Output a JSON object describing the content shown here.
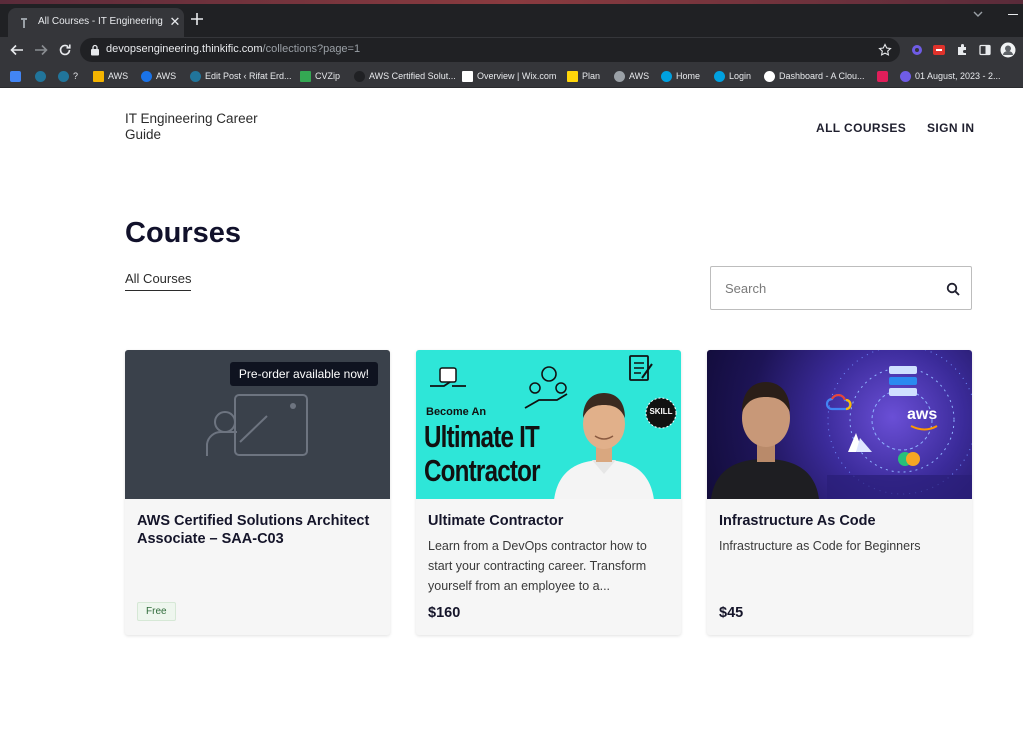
{
  "browser": {
    "tab_title": "All Courses - IT Engineering Career",
    "tab_close": "✕",
    "url_host": "devopsengineering.thinkific.com",
    "url_path": "/collections?page=1",
    "bookmarks": [
      {
        "label": "",
        "color": "#4285f4"
      },
      {
        "label": "",
        "color": "#21759b"
      },
      {
        "label": "?",
        "color": "#21759b"
      },
      {
        "label": "AWS",
        "color": "#f4b400"
      },
      {
        "label": "AWS",
        "color": "#1a73e8"
      },
      {
        "label": "Edit Post ‹ Rifat Erd...",
        "color": "#21759b"
      },
      {
        "label": "CVZip",
        "color": "#34a853"
      },
      {
        "label": "AWS Certified Solut...",
        "color": "#202124"
      },
      {
        "label": "Overview | Wix.com",
        "color": "#ffffff"
      },
      {
        "label": "Plan",
        "color": "#ffd60a"
      },
      {
        "label": "AWS",
        "color": "#9aa0a6"
      },
      {
        "label": "Home",
        "color": "#00a1e0"
      },
      {
        "label": "Login",
        "color": "#00a1e0"
      },
      {
        "label": "Dashboard - A Clou...",
        "color": "#ffffff"
      },
      {
        "label": "",
        "color": "#e01e5a"
      },
      {
        "label": "01 August, 2023 - 2...",
        "color": "#6f5ce6"
      }
    ]
  },
  "site": {
    "brand": "IT Engineering Career Guide",
    "nav": {
      "all_courses": "ALL COURSES",
      "sign_in": "SIGN IN"
    },
    "heading": "Courses",
    "filter": "All Courses",
    "search_placeholder": "Search"
  },
  "courses": [
    {
      "title": "AWS Certified Solutions Architect Associate – SAA-C03",
      "description": "",
      "badge": "Free",
      "price": "",
      "overlay": "Pre-order available now!",
      "image": "placeholder-presentation"
    },
    {
      "title": "Ultimate Contractor",
      "description": "Learn from a DevOps contractor how to start your contracting career. Transform yourself from an employee to a...",
      "price": "$160",
      "image_text": {
        "line1": "Become An",
        "line2": "Ultimate IT",
        "line3": "Contractor",
        "skill": "SKILL"
      }
    },
    {
      "title": "Infrastructure As Code",
      "description": "Infrastructure as Code for Beginners",
      "price": "$45",
      "image_text": {
        "aws": "aws",
        "network": "network"
      }
    }
  ]
}
